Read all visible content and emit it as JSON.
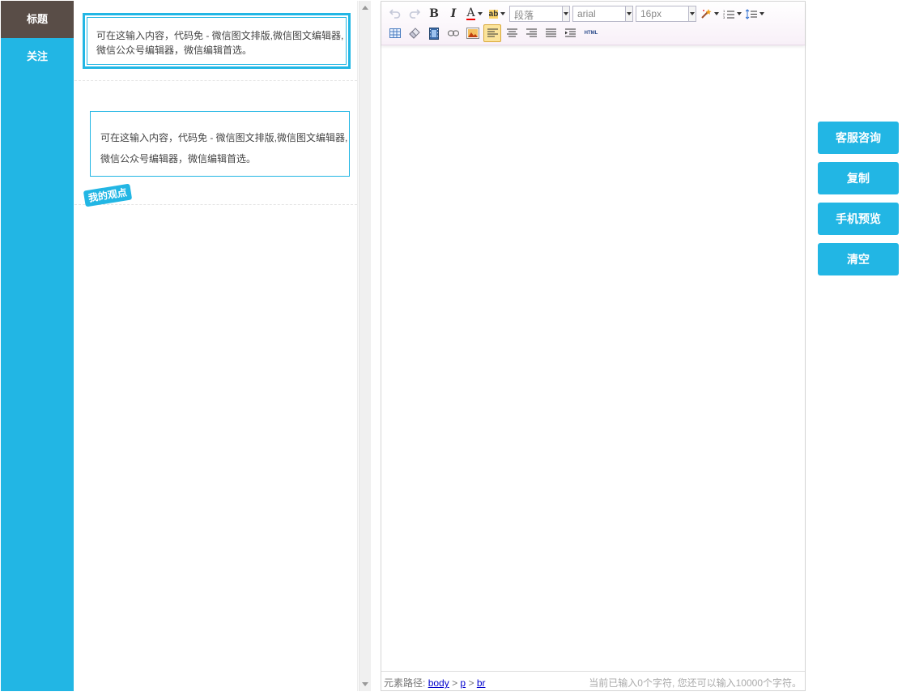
{
  "sidebar": {
    "items": [
      {
        "label": "标题"
      },
      {
        "label": "关注"
      }
    ]
  },
  "templates": [
    {
      "text": "可在这输入内容，代码免 - 微信图文排版,微信图文编辑器,微信公众号编辑器，微信编辑首选。"
    },
    {
      "tag": "我的观点",
      "text": "可在这输入内容，代码免 - 微信图文排版,微信图文编辑器,微信公众号编辑器，微信编辑首选。"
    }
  ],
  "toolbar": {
    "bold": "B",
    "italic": "I",
    "font_color": "A",
    "back_color": "ab",
    "paragraph": "段落",
    "font_family": "arial",
    "font_size": "16px",
    "html_label": "HTML"
  },
  "statusbar": {
    "path_label": "元素路径:",
    "path": [
      "body",
      "p",
      "br"
    ],
    "separator": ">",
    "count_text": "当前已输入0个字符, 您还可以输入10000个字符。"
  },
  "actions": [
    {
      "label": "客服咨询"
    },
    {
      "label": "复制"
    },
    {
      "label": "手机预览"
    },
    {
      "label": "清空"
    }
  ],
  "colors": {
    "accent": "#22b6e4",
    "sidebar_active": "#594d47"
  }
}
